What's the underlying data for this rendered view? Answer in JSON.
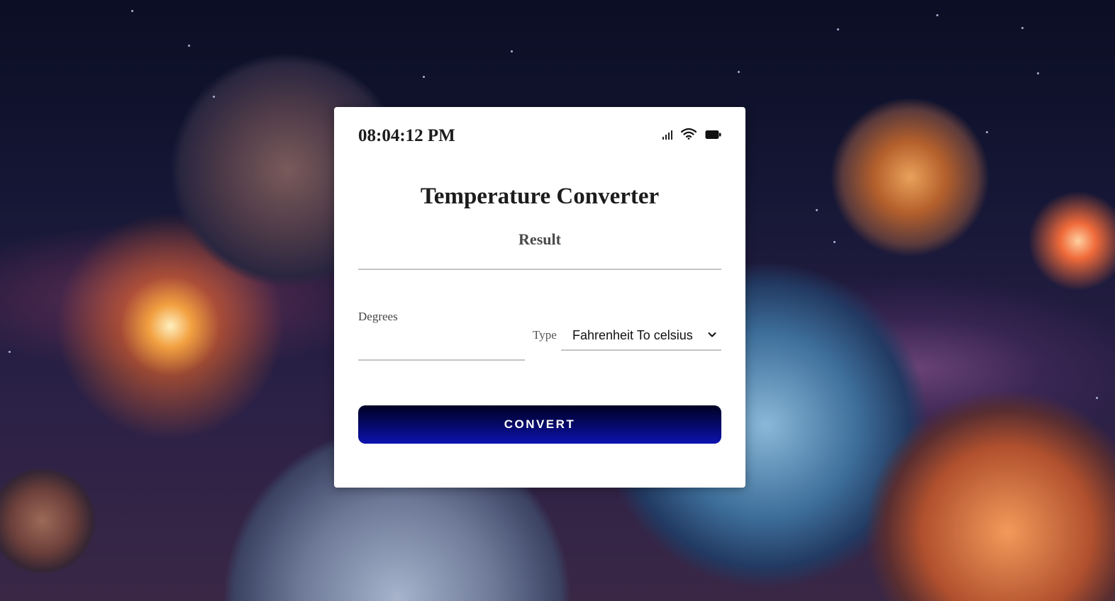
{
  "status_bar": {
    "time": "08:04:12 PM",
    "icons": [
      "signal-icon",
      "wifi-icon",
      "battery-icon"
    ]
  },
  "converter": {
    "title": "Temperature Converter",
    "result_label": "Result",
    "degrees_label": "Degrees",
    "degrees_value": "",
    "type_label": "Type",
    "type_selected": "Fahrenheit To celsius",
    "convert_label": "CONVERT"
  },
  "colors": {
    "button_gradient_top": "#000022",
    "button_gradient_bottom": "#0d12b0",
    "card_background": "#ffffff"
  }
}
